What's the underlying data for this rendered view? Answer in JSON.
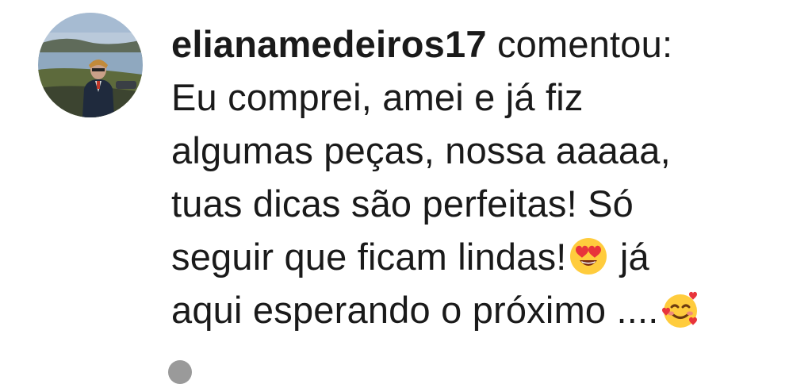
{
  "comment": {
    "username": "elianamedeiros17",
    "verb": "comentou:",
    "lines": [
      "Eu comprei, amei e já fiz",
      "algumas peças, nossa aaaaa,",
      "tuas dicas são perfeitas!  Só"
    ],
    "line4_text": "seguir que ficam lindas!",
    "line4_after": " já",
    "line5_text": "aqui esperando o próximo ....",
    "emojis": [
      "heart-eyes-emoji",
      "smiling-face-with-hearts-emoji"
    ]
  },
  "colors": {
    "text": "#1a1a1a",
    "background": "#ffffff",
    "emoji_yellow": "#ffcc3d",
    "emoji_red": "#e8343b"
  }
}
